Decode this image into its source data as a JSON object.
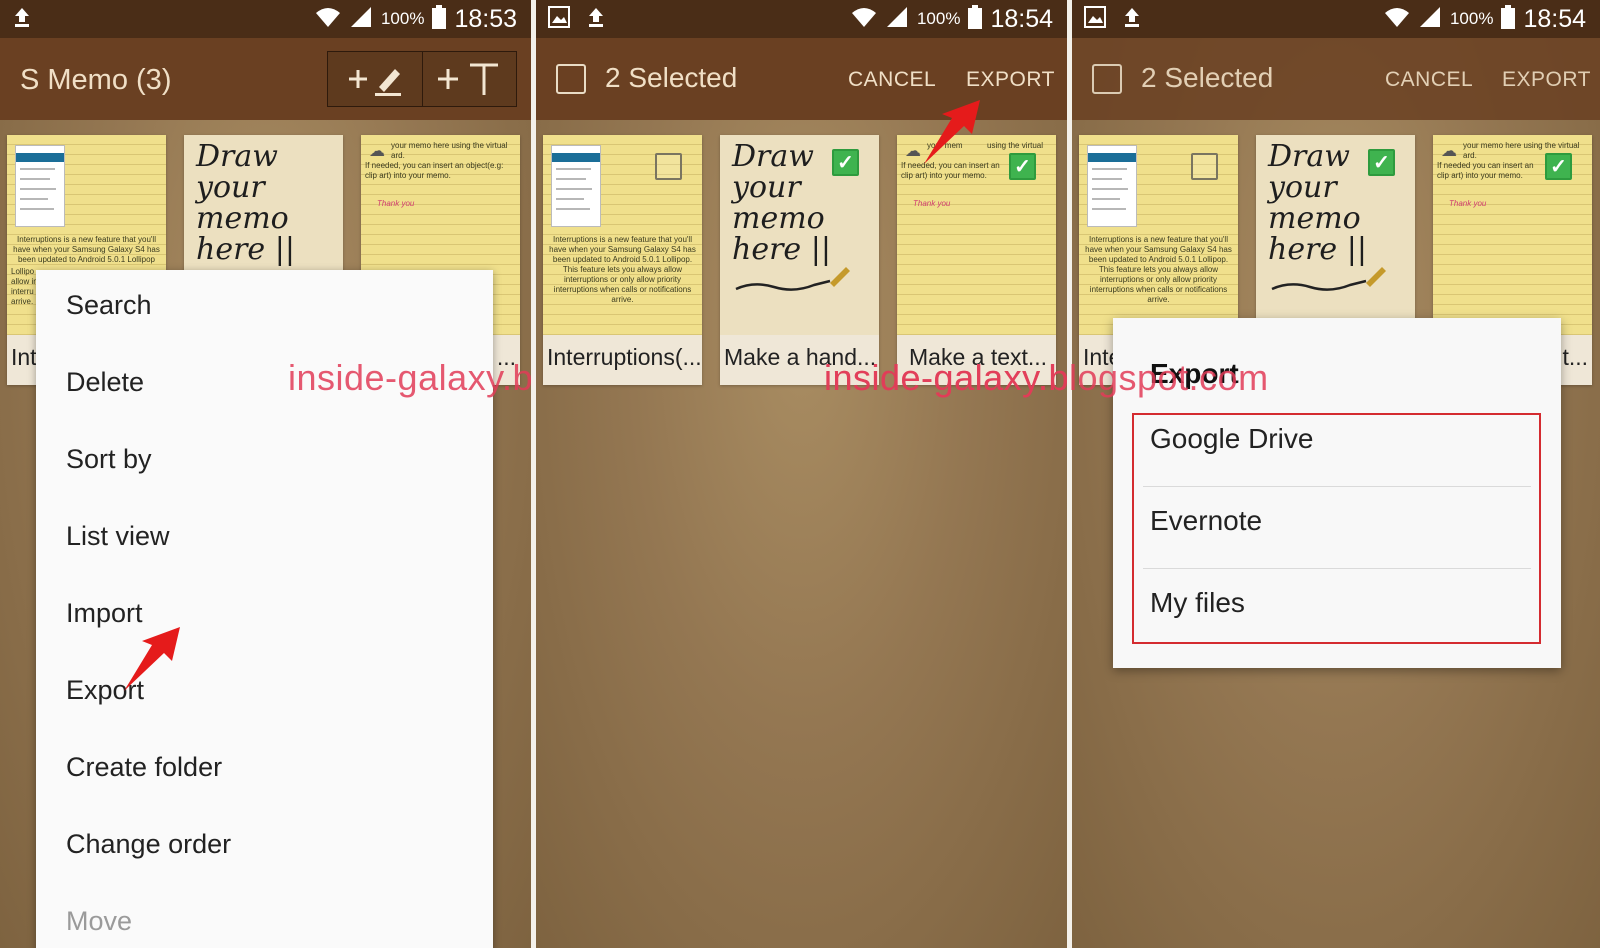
{
  "status_left": {
    "time": "18:53",
    "battery": "100%"
  },
  "status_right": {
    "time": "18:54",
    "battery": "100%"
  },
  "panel1": {
    "title": "S Memo (3)",
    "new_handwriting": "+✍",
    "new_text": "+T",
    "menu": [
      "Search",
      "Delete",
      "Sort by",
      "List view",
      "Import",
      "Export",
      "Create folder",
      "Change order",
      "Move"
    ]
  },
  "panel2": {
    "selected": "2 Selected",
    "cancel": "CANCEL",
    "export": "EXPORT"
  },
  "panel3": {
    "selected": "2 Selected",
    "cancel": "CANCEL",
    "export": "EXPORT",
    "dialog_title": "Export",
    "options": [
      "Google Drive",
      "Evernote",
      "My files"
    ]
  },
  "memos": {
    "memo1_label": "Interruptions(...",
    "memo1_label_short": "Int",
    "memo1_label_short3": "Inte",
    "memo1_text": "Interruptions is a new feature that you'll have when your Samsung Galaxy S4 has been updated to Android 5.0.1 Lollipop. This feature lets you always allow interruptions or only allow priority interruptions when calls or notifications arrive.",
    "memo1_text_p1": "Interruptions is a new feature that you'll have when your Samsung Galaxy S4 has been updated to Android 5.0.1 Lollipop",
    "memo1_text_p1_lines": [
      "Lollipo",
      "allow in",
      "interru",
      "arrive."
    ],
    "memo2_label": "Make a hand...",
    "memo2_hand": "Draw your memo here !!!",
    "memo2_hand_short": "Draw your memo here ||",
    "memo3_label": "Make a text...",
    "memo3_label_short": "...",
    "memo3_label_short3": "t...",
    "memo3_text1": "your memo here using the virtual",
    "memo3_text1_short": "your mem",
    "memo3_text1_end": "using the virtual",
    "memo3_text2": "ard.",
    "memo3_text3": "If needed, you can insert an object(e.g: clip art) into your memo.",
    "memo3_text3_short": "If needed, you can insert an",
    "memo3_text3_end": "clip art) into your memo.",
    "memo3_text3_short2": "If needed you can insert an",
    "memo3_thanks": "Thank you",
    "check_mark": "✓"
  },
  "watermark": "inside-galaxy.blogspot.com"
}
